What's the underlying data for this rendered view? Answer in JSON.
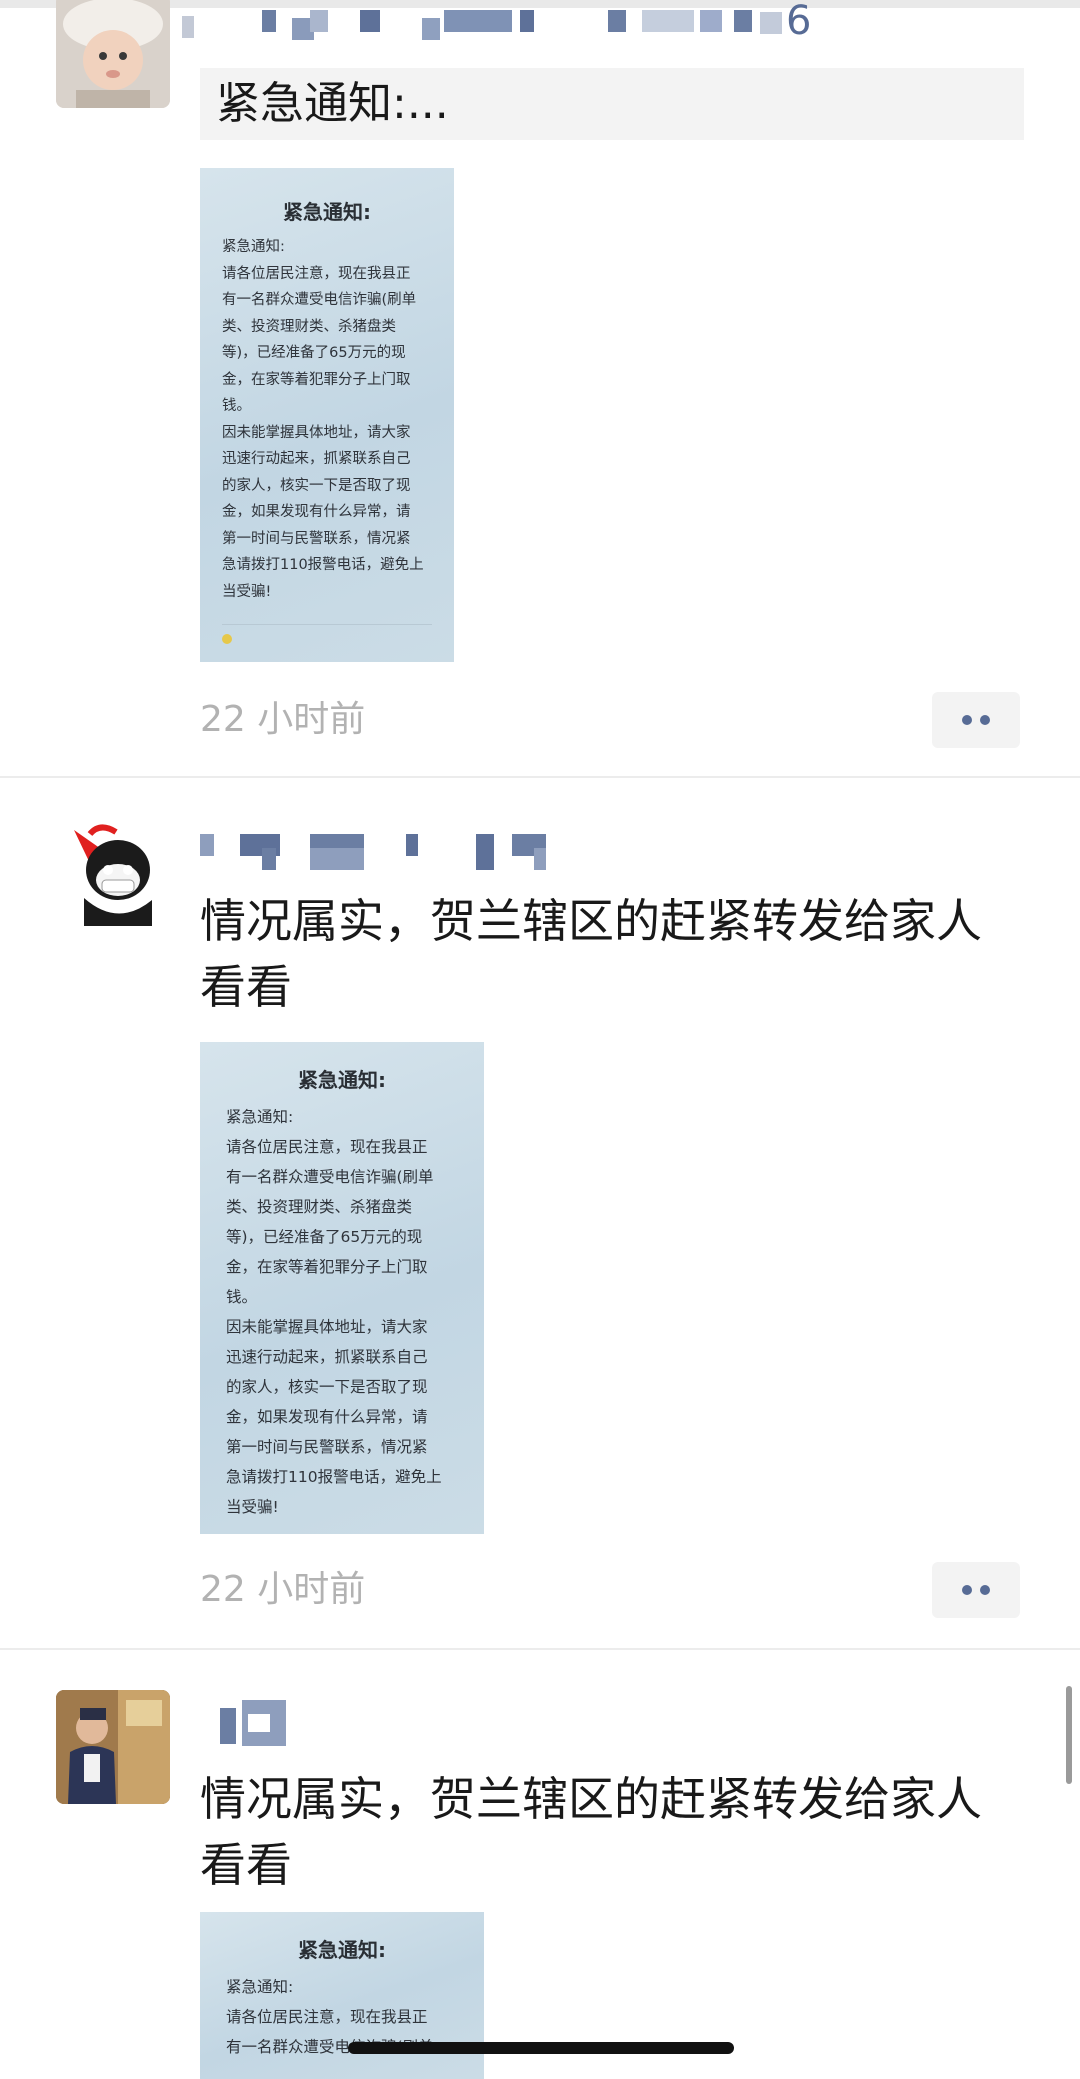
{
  "posts": [
    {
      "name_tail": "6",
      "quote_text": "紧急通知:...",
      "time": "22 小时前"
    },
    {
      "text": "情况属实，贺兰辖区的赶紧转发给家人看看",
      "time": "22 小时前"
    },
    {
      "text": "情况属实，贺兰辖区的赶紧转发给家人看看"
    }
  ],
  "notice": {
    "title": "紧急通知:",
    "body": "紧急通知:\n请各位居民注意，现在我县正\n有一名群众遭受电信诈骗(刷单\n类、投资理财类、杀猪盘类\n等)，已经准备了65万元的现\n金，在家等着犯罪分子上门取\n钱。\n因未能掌握具体地址，请大家\n迅速行动起来，抓紧联系自己\n的家人，核实一下是否取了现\n金，如果发现有什么异常，请\n第一时间与民警联系，情况紧\n急请拨打110报警电话，避免上\n当受骗!",
    "body_partial": "紧急通知:\n请各位居民注意，现在我县正\n有一名群众遭受电信诈骗(刷单"
  },
  "colors": {
    "name_link": "#576b95",
    "time_gray": "#b2b2b2",
    "notice_bg": "#c8dae6"
  },
  "icons": {
    "more": "more-dots-icon"
  }
}
